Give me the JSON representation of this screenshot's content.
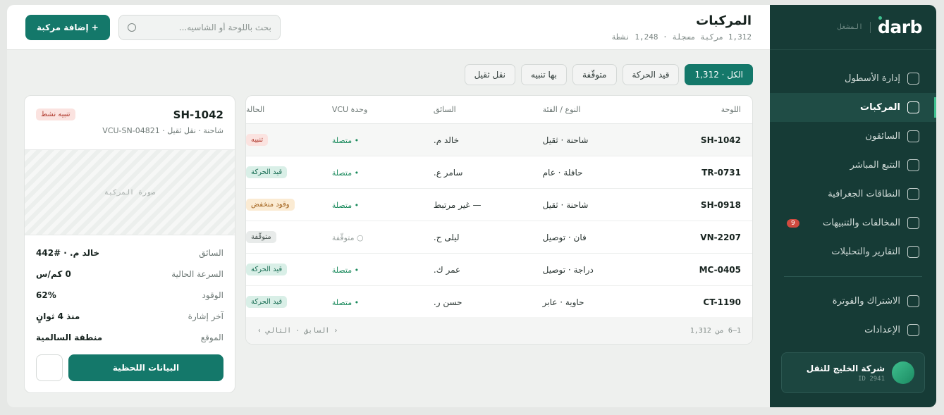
{
  "sidebar": {
    "brand": "darb",
    "brand_sub": "المشغل",
    "items": [
      {
        "label": "إدارة الأسطول"
      },
      {
        "label": "المركبات"
      },
      {
        "label": "السائقون"
      },
      {
        "label": "التتبع المباشر"
      },
      {
        "label": "النطاقات الجغرافية"
      },
      {
        "label": "المخالفات والتنبيهات",
        "badge": "9"
      },
      {
        "label": "التقارير والتحليلات"
      }
    ],
    "bottom_items": [
      {
        "label": "الاشتراك والفوترة"
      },
      {
        "label": "الإعدادات"
      }
    ],
    "org": {
      "name": "شركة الخليج للنقل",
      "id": "ID 2941"
    }
  },
  "header": {
    "title": "المركبات",
    "subtitle": "1,312 مركبة مسجلة · 1,248 نشطة",
    "search_placeholder": "بحث باللوحة أو الشاسيه...",
    "add_label": "+ إضافة مركبة"
  },
  "filters": [
    "الكل · 1,312",
    "قيد الحركة",
    "متوقّفة",
    "بها تنبيه",
    "نقل ثقيل"
  ],
  "table": {
    "headers": {
      "plate": "اللوحة",
      "type": "النوع / الفئة",
      "driver": "السائق",
      "vcu": "وحدة VCU",
      "status": "الحالة"
    },
    "rows": [
      {
        "plate": "SH-1042",
        "type": "شاحنة · ثقيل",
        "driver": "خالد م.",
        "vcu": "• متصلة",
        "status": "تنبيه"
      },
      {
        "plate": "TR-0731",
        "type": "حافلة · عام",
        "driver": "سامر ع.",
        "vcu": "• متصلة",
        "status": "قيد الحركة"
      },
      {
        "plate": "SH-0918",
        "type": "شاحنة · ثقيل",
        "driver": "— غير مرتبط",
        "vcu": "• متصلة",
        "status": "وقود منخفض"
      },
      {
        "plate": "VN-2207",
        "type": "فان · توصيل",
        "driver": "ليلى ح.",
        "vcu": "○ متوقّفة",
        "status": "متوقّفة"
      },
      {
        "plate": "MC-0405",
        "type": "دراجة · توصيل",
        "driver": "عمر ك.",
        "vcu": "• متصلة",
        "status": "قيد الحركة"
      },
      {
        "plate": "CT-1190",
        "type": "حاوية · عابر",
        "driver": "حسن ر.",
        "vcu": "• متصلة",
        "status": "قيد الحركة"
      }
    ],
    "footer_count": "1–6 من 1,312",
    "prev": "‹ السابق",
    "sep": "·",
    "next": "التالي ›"
  },
  "detail": {
    "plate": "SH-1042",
    "badge": "تنبيه نشط",
    "sub": "شاحنة · نقل ثقيل · VCU-SN-04821",
    "image_label": "صورة المركبة",
    "fields": [
      {
        "key": "السائق",
        "value": "خالد م. · #442"
      },
      {
        "key": "السرعة الحالية",
        "value": "0 كم/س"
      },
      {
        "key": "الوقود",
        "value": "62%"
      },
      {
        "key": "آخر إشارة",
        "value": "منذ 4 ثوانٍ"
      },
      {
        "key": "الموقع",
        "value": "منطقة السالمية"
      }
    ],
    "live_label": "البيانات اللحظية"
  },
  "colors": {
    "accent": "#14786a",
    "sidebar": "#163b36",
    "alert": "#d04a3f"
  }
}
